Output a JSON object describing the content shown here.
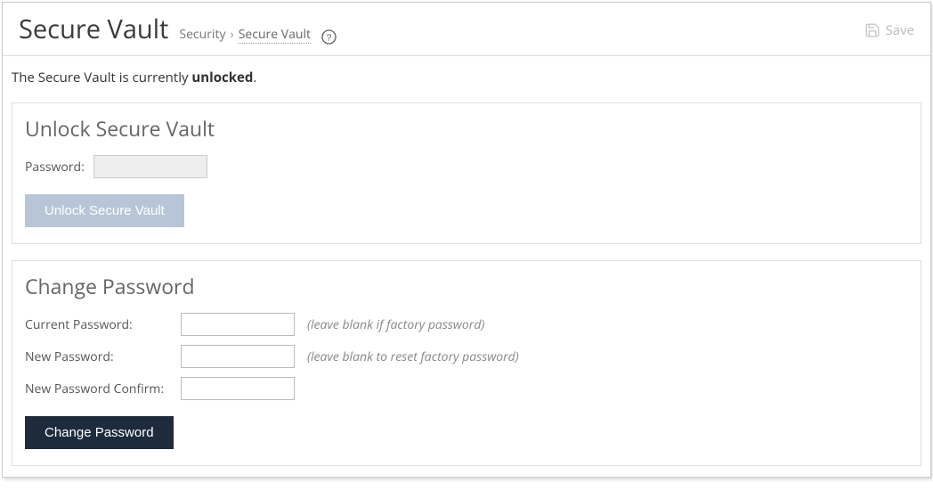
{
  "header": {
    "title": "Secure Vault",
    "breadcrumb": {
      "parent": "Security",
      "current": "Secure Vault"
    },
    "save_label": "Save"
  },
  "status": {
    "prefix": "The Secure Vault is currently ",
    "state": "unlocked",
    "suffix": "."
  },
  "unlock_panel": {
    "title": "Unlock Secure Vault",
    "password_label": "Password:",
    "button_label": "Unlock Secure Vault"
  },
  "change_panel": {
    "title": "Change Password",
    "current_label": "Current Password:",
    "current_hint": "(leave blank if factory password)",
    "new_label": "New Password:",
    "new_hint": "(leave blank to reset factory password)",
    "confirm_label": "New Password Confirm:",
    "button_label": "Change Password"
  }
}
